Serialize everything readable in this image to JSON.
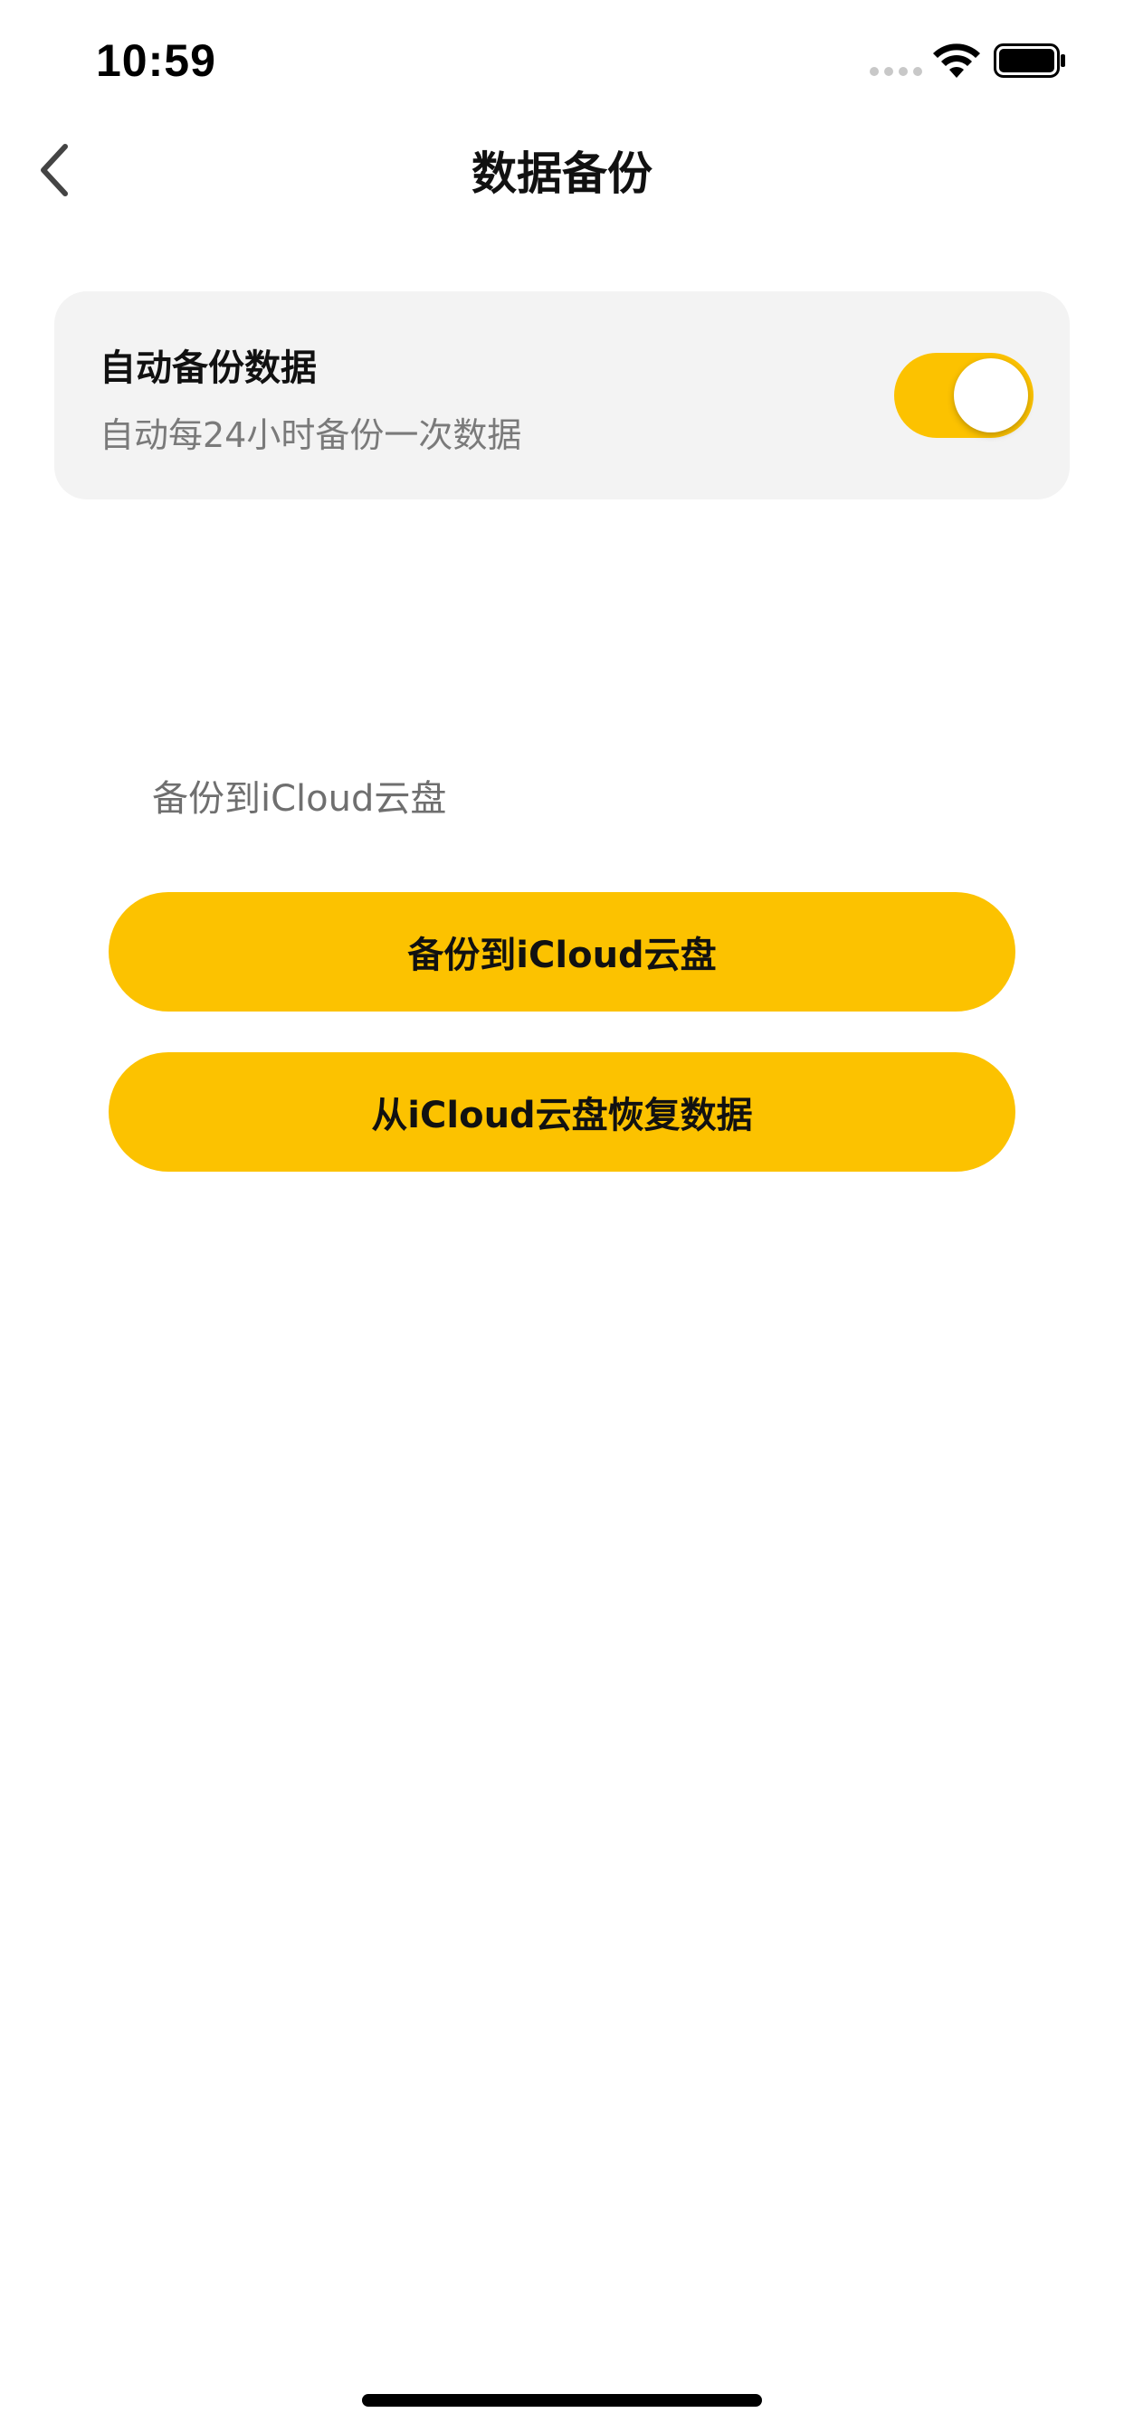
{
  "status_bar": {
    "time": "10:59"
  },
  "nav": {
    "title": "数据备份",
    "back_icon": "chevron-left-icon"
  },
  "auto_backup": {
    "title": "自动备份数据",
    "description": "自动每24小时备份一次数据",
    "enabled": true
  },
  "icloud": {
    "section_label": "备份到iCloud云盘",
    "backup_button_label": "备份到iCloud云盘",
    "restore_button_label": "从iCloud云盘恢复数据"
  },
  "colors": {
    "accent": "#fcc200",
    "card_background": "#f3f3f3",
    "secondary_text": "#7a7a7a"
  }
}
